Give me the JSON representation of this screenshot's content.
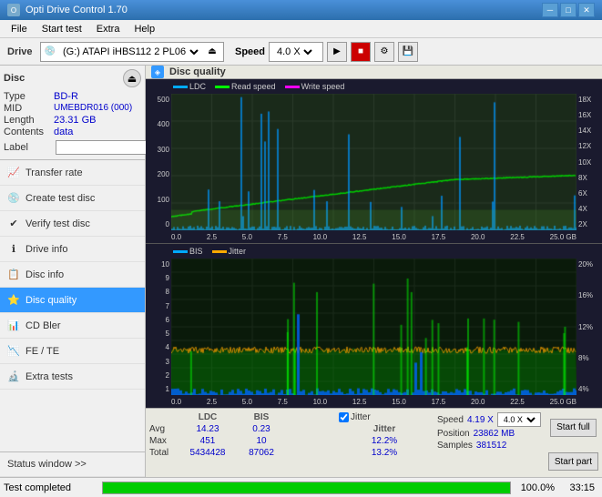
{
  "titleBar": {
    "title": "Opti Drive Control 1.70",
    "minBtn": "─",
    "maxBtn": "□",
    "closeBtn": "✕"
  },
  "menuBar": {
    "items": [
      "File",
      "Start test",
      "Extra",
      "Help"
    ]
  },
  "toolbar": {
    "driveLabel": "Drive",
    "driveValue": "(G:) ATAPI iHBS112  2 PL06",
    "speedLabel": "Speed",
    "speedValue": "4.0 X"
  },
  "disc": {
    "title": "Disc",
    "typeLabel": "Type",
    "typeValue": "BD-R",
    "midLabel": "MID",
    "midValue": "UMEBDR016 (000)",
    "lengthLabel": "Length",
    "lengthValue": "23.31 GB",
    "contentsLabel": "Contents",
    "contentsValue": "data",
    "labelLabel": "Label"
  },
  "sidebarItems": [
    {
      "id": "transfer-rate",
      "label": "Transfer rate",
      "icon": "📈",
      "active": false
    },
    {
      "id": "create-test-disc",
      "label": "Create test disc",
      "icon": "💿",
      "active": false
    },
    {
      "id": "verify-test-disc",
      "label": "Verify test disc",
      "icon": "✅",
      "active": false
    },
    {
      "id": "drive-info",
      "label": "Drive info",
      "icon": "ℹ",
      "active": false
    },
    {
      "id": "disc-info",
      "label": "Disc info",
      "icon": "📋",
      "active": false
    },
    {
      "id": "disc-quality",
      "label": "Disc quality",
      "icon": "⭐",
      "active": true
    },
    {
      "id": "cd-bler",
      "label": "CD Bler",
      "icon": "📊",
      "active": false
    },
    {
      "id": "fe-te",
      "label": "FE / TE",
      "icon": "📉",
      "active": false
    },
    {
      "id": "extra-tests",
      "label": "Extra tests",
      "icon": "🔬",
      "active": false
    }
  ],
  "statusWindow": {
    "label": "Status window >>"
  },
  "chartTitle": "Disc quality",
  "legend": {
    "top": [
      {
        "label": "LDC",
        "color": "#00aaff"
      },
      {
        "label": "Read speed",
        "color": "#00ff00"
      },
      {
        "label": "Write speed",
        "color": "#ff00ff"
      }
    ],
    "bottom": [
      {
        "label": "BIS",
        "color": "#00aaff"
      },
      {
        "label": "Jitter",
        "color": "#ff8800"
      }
    ]
  },
  "topChart": {
    "yLabels": [
      "500",
      "400",
      "300",
      "200",
      "100",
      "0"
    ],
    "yLabelsRight": [
      "18X",
      "16X",
      "14X",
      "12X",
      "10X",
      "8X",
      "6X",
      "4X",
      "2X"
    ],
    "xLabels": [
      "0.0",
      "2.5",
      "5.0",
      "7.5",
      "10.0",
      "12.5",
      "15.0",
      "17.5",
      "20.0",
      "22.5",
      "25.0"
    ]
  },
  "bottomChart": {
    "yLabels": [
      "10",
      "9",
      "8",
      "7",
      "6",
      "5",
      "4",
      "3",
      "2",
      "1"
    ],
    "yLabelsRight": [
      "20%",
      "16%",
      "12%",
      "8%",
      "4%"
    ],
    "xLabels": [
      "0.0",
      "2.5",
      "5.0",
      "7.5",
      "10.0",
      "12.5",
      "15.0",
      "17.5",
      "20.0",
      "22.5",
      "25.0"
    ]
  },
  "stats": {
    "columns": [
      "",
      "LDC",
      "BIS",
      "",
      "Jitter",
      "Speed",
      ""
    ],
    "rows": [
      {
        "label": "Avg",
        "ldc": "14.23",
        "bis": "0.23",
        "jitter": "12.2%",
        "speed": "4.19 X",
        "speedSelect": "4.0 X"
      },
      {
        "label": "Max",
        "ldc": "451",
        "bis": "10",
        "jitter": "13.2%",
        "position": "23862 MB"
      },
      {
        "label": "Total",
        "ldc": "5434428",
        "bis": "87062",
        "samples": "381512"
      }
    ],
    "jitterChecked": true,
    "jitterLabel": "Jitter",
    "speedLabel": "Speed",
    "speedValue": "4.19 X",
    "speedSelectValue": "4.0 X",
    "positionLabel": "Position",
    "positionValue": "23862 MB",
    "samplesLabel": "Samples",
    "samplesValue": "381512",
    "startFullBtn": "Start full",
    "startPartBtn": "Start part"
  },
  "bottomStatus": {
    "statusText": "Test completed",
    "progressPercent": "100.0%",
    "progressValue": 100,
    "time": "33:15"
  }
}
